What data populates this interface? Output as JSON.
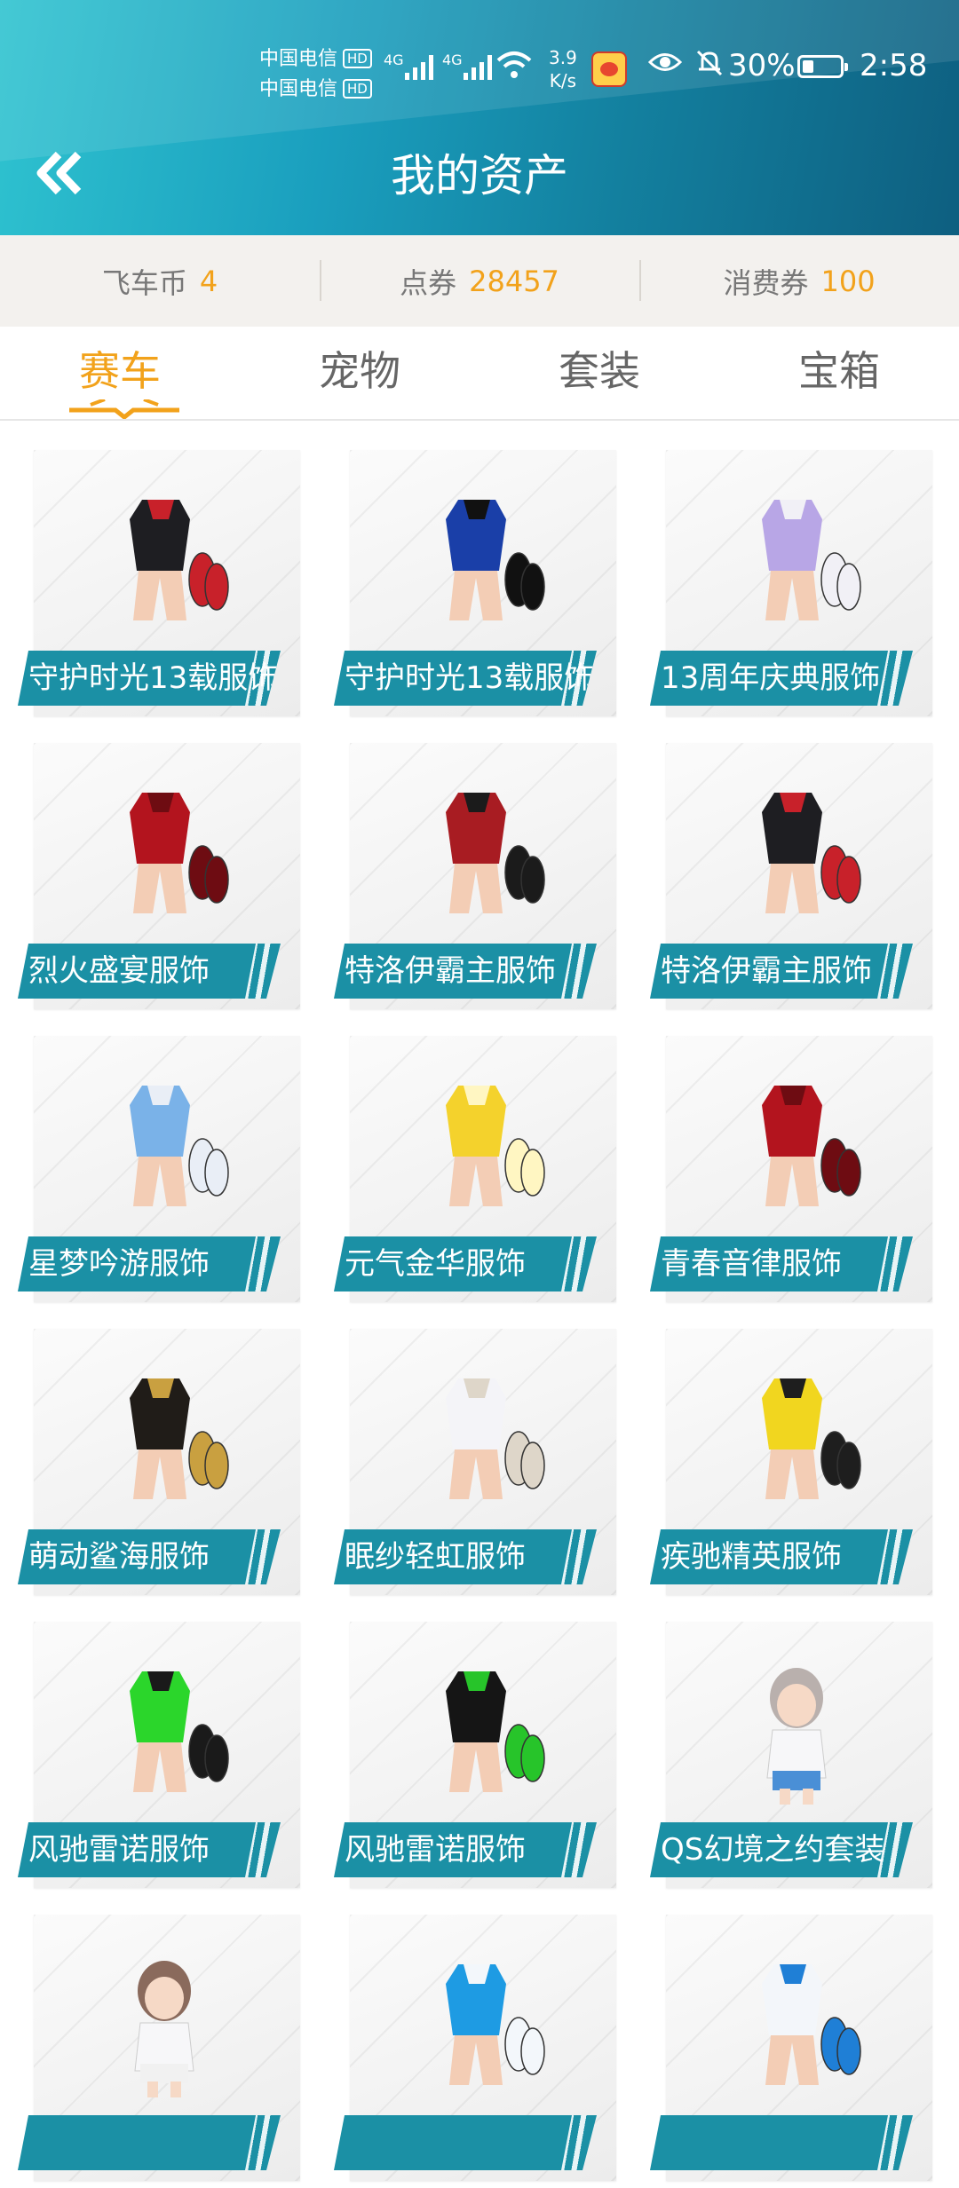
{
  "status_bar": {
    "carrier_1": "中国电信",
    "carrier_2": "中国电信",
    "hd": "HD",
    "net_1": "4G",
    "net_2": "4G",
    "speed_value": "3.9",
    "speed_unit": "K/s",
    "battery": "30%",
    "time": "2:58"
  },
  "header": {
    "title": "我的资产"
  },
  "assets": [
    {
      "label": "飞车币",
      "value": "4"
    },
    {
      "label": "点券",
      "value": "28457"
    },
    {
      "label": "消费券",
      "value": "100"
    }
  ],
  "tabs": [
    {
      "label": "赛车",
      "active": true
    },
    {
      "label": "宠物",
      "active": false
    },
    {
      "label": "套装",
      "active": false
    },
    {
      "label": "宝箱",
      "active": false
    }
  ],
  "items": [
    {
      "name": "守护时光13载服饰",
      "icon": "outfit-black-red-icon"
    },
    {
      "name": "守护时光13载服饰",
      "icon": "outfit-blue-black-icon"
    },
    {
      "name": "13周年庆典服饰",
      "icon": "outfit-purple-white-icon"
    },
    {
      "name": "烈火盛宴服饰",
      "icon": "outfit-red-dress-icon"
    },
    {
      "name": "特洛伊霸主服饰",
      "icon": "outfit-red-black-icon"
    },
    {
      "name": "特洛伊霸主服饰",
      "icon": "outfit-black-red-icon"
    },
    {
      "name": "星梦吟游服饰",
      "icon": "outfit-blue-gown-icon"
    },
    {
      "name": "元气金华服饰",
      "icon": "outfit-yellow-dress-icon"
    },
    {
      "name": "青春音律服饰",
      "icon": "outfit-red-dress-icon"
    },
    {
      "name": "萌动鲨海服饰",
      "icon": "outfit-black-gold-icon"
    },
    {
      "name": "眠纱轻虹服饰",
      "icon": "outfit-white-gown-icon"
    },
    {
      "name": "疾驰精英服饰",
      "icon": "outfit-yellow-black-icon"
    },
    {
      "name": "风驰雷诺服饰",
      "icon": "outfit-green-black-icon"
    },
    {
      "name": "风驰雷诺服饰",
      "icon": "outfit-black-green-icon"
    },
    {
      "name": "QS幻境之约套装",
      "icon": "character-girl-icon"
    },
    {
      "name": "",
      "icon": "character-boy-icon"
    },
    {
      "name": "",
      "icon": "outfit-blue-white-icon"
    },
    {
      "name": "",
      "icon": "outfit-white-blue-icon"
    }
  ],
  "colors": {
    "accent": "#f2a21b",
    "label_bg": "#1b90a5",
    "header_start": "#2fc3d0",
    "header_end": "#0e5f80"
  }
}
